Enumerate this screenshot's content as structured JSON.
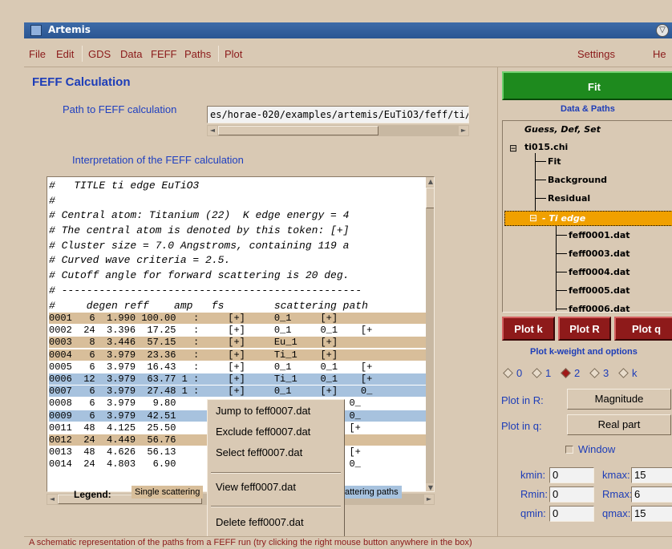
{
  "window": {
    "title": "Artemis"
  },
  "menubar": {
    "items": [
      "File",
      "Edit",
      "GDS",
      "Data",
      "FEFF",
      "Paths",
      "Plot"
    ],
    "right_items": [
      "Settings",
      "He"
    ]
  },
  "left": {
    "heading": "FEFF Calculation",
    "path_label": "Path to FEFF calculation",
    "path_value": "es/horae-020/examples/artemis/EuTiO3/feff/ti/",
    "interp_label": "Interpretation of the FEFF calculation",
    "header_lines": [
      "#   TITLE ti edge EuTiO3",
      "#",
      "# Central atom: Titanium (22)  K edge energy = 4",
      "# The central atom is denoted by this token: [+]",
      "# Cluster size = 7.0 Angstroms, containing 119 a",
      "# Curved wave criteria = 2.5.",
      "# Cutoff angle for forward scattering is 20 deg.",
      "# ------------------------------------------------",
      "#     degen reff    amp   fs        scattering path"
    ],
    "rows": [
      {
        "text": "0001   6  1.990 100.00   :     [+]     0_1     [+]",
        "style": "tan"
      },
      {
        "text": "0002  24  3.396  17.25   :     [+]     0_1     0_1    [+",
        "style": "white"
      },
      {
        "text": "0003   8  3.446  57.15   :     [+]     Eu_1    [+]",
        "style": "tan"
      },
      {
        "text": "0004   6  3.979  23.36   :     [+]     Ti_1    [+]",
        "style": "tan"
      },
      {
        "text": "0005   6  3.979  16.43   :     [+]     0_1     0_1    [+",
        "style": "white"
      },
      {
        "text": "0006  12  3.979  63.77 1 :     [+]     Ti_1    0_1    [+",
        "style": "blue"
      },
      {
        "text": "0007   6  3.979  27.48 1 :     [+]     0_1     [+]    0_",
        "style": "blue"
      },
      {
        "text": "0008   6  3.979   9.80               0_1     0_1    0_",
        "style": "white"
      },
      {
        "text": "0009   6  3.979  42.51               0_1     Ti_1   0_",
        "style": "blue"
      },
      {
        "text": "0011  48  4.125  25.50               0_1     0_1    [+",
        "style": "white"
      },
      {
        "text": "0012  24  4.449  56.76               0_1     [+]",
        "style": "tan"
      },
      {
        "text": "0013  48  4.626  56.13               0_1     0_1    [+",
        "style": "white"
      },
      {
        "text": "0014  24  4.803   6.90               0_1     0_1    0_",
        "style": "white"
      }
    ],
    "legend": {
      "label": "Legend:",
      "single": "Single scattering",
      "multiple": "attering paths"
    }
  },
  "context_menu": {
    "items": [
      "Jump to feff0007.dat",
      "Exclude feff0007.dat",
      "Select feff0007.dat",
      "View feff0007.dat",
      "Delete feff0007.dat"
    ]
  },
  "status": "A schematic representation of the paths from a FEFF run (try clicking the right mouse button anywhere in the box)",
  "right": {
    "fit_label": "Fit",
    "data_paths_label": "Data & Paths",
    "tree": {
      "gds": "Guess, Def, Set",
      "data": "ti015.chi",
      "children": [
        "Fit",
        "Background",
        "Residual"
      ],
      "feff_node": "Ti edge",
      "feff_files": [
        "feff0001.dat",
        "feff0003.dat",
        "feff0004.dat",
        "feff0005.dat",
        "feff0006.dat"
      ]
    },
    "plot_buttons": [
      "Plot k",
      "Plot R",
      "Plot q"
    ],
    "kweight_label": "Plot k-weight and options",
    "kweights": [
      "0",
      "1",
      "2",
      "3",
      "k"
    ],
    "kweight_selected": "2",
    "plot_in_r_label": "Plot in R:",
    "plot_in_r_value": "Magnitude",
    "plot_in_q_label": "Plot in q:",
    "plot_in_q_value": "Real part",
    "window_label": "Window",
    "fields": {
      "kmin_label": "kmin:",
      "kmin": "0",
      "kmax_label": "kmax:",
      "kmax": "15",
      "rmin_label": "Rmin:",
      "rmin": "0",
      "rmax_label": "Rmax:",
      "rmax": "6",
      "qmin_label": "qmin:",
      "qmin": "0",
      "qmax_label": "qmax:",
      "qmax": "15"
    }
  },
  "colors": {
    "background": "#d9c9b4",
    "fit_green": "#1e8a1e",
    "plot_red": "#8e1a1a",
    "heading_blue": "#1d3db8",
    "single_scatter_tan": "#d8be9a",
    "multiple_scatter_blue": "#a7c2de",
    "selected_node_orange": "#f0a000"
  }
}
